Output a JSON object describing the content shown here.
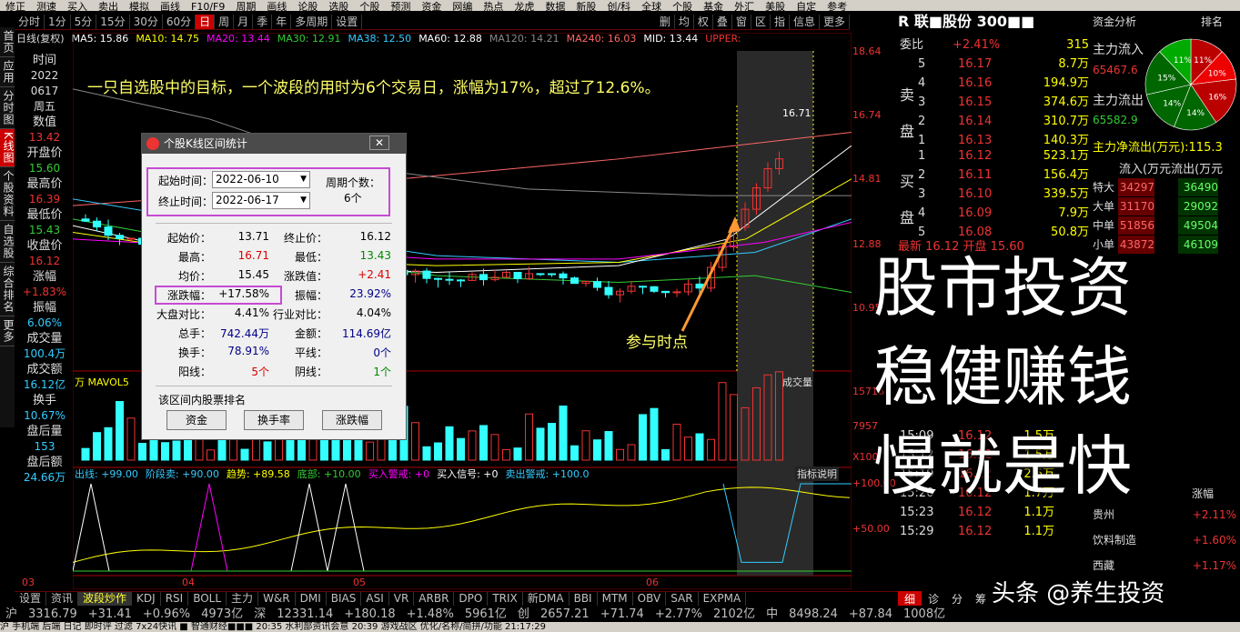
{
  "toolbar": {
    "items": [
      "修正",
      "测速",
      "买入",
      "卖出",
      "模拟",
      "画线",
      "F10/F9",
      "周期",
      "画线",
      "论股",
      "选股",
      "个股",
      "预测",
      "资金",
      "网编",
      "热点",
      "龙虎",
      "数据",
      "新股",
      "创/科",
      "全球",
      "个股",
      "基金",
      "外汇",
      "美股",
      "自定",
      "参考"
    ]
  },
  "period_tabs": [
    "分时",
    "1分",
    "5分",
    "15分",
    "30分",
    "60分",
    "日",
    "周",
    "月",
    "季",
    "年",
    "多周期",
    "设置"
  ],
  "period_active": "日",
  "period_right": [
    "删",
    "均",
    "权",
    "叠",
    "窗",
    "区",
    "指",
    "信息",
    "更多"
  ],
  "left_nav": [
    "首页",
    "应用",
    "分时图",
    "K线图",
    "个股资料",
    "自选股",
    "综合排名",
    "更多"
  ],
  "left_nav_active": "K线图",
  "info": [
    {
      "label": "时间",
      "value": "2022",
      "color": "#ddd"
    },
    {
      "label": "",
      "value": "0617",
      "color": "#ddd"
    },
    {
      "label": "",
      "value": "周五",
      "color": "#ddd"
    },
    {
      "label": "数值",
      "value": "13.42",
      "color": "#e33"
    },
    {
      "label": "开盘价",
      "value": "15.60",
      "color": "#3c3"
    },
    {
      "label": "最高价",
      "value": "16.39",
      "color": "#e33"
    },
    {
      "label": "最低价",
      "value": "15.43",
      "color": "#3c3"
    },
    {
      "label": "收盘价",
      "value": "16.12",
      "color": "#e33"
    },
    {
      "label": "涨幅",
      "value": "+1.83%",
      "color": "#e33"
    },
    {
      "label": "振幅",
      "value": "6.06%",
      "color": "#3cf"
    },
    {
      "label": "成交量",
      "value": "100.4万",
      "color": "#3cf"
    },
    {
      "label": "成交额",
      "value": "16.12亿",
      "color": "#3cf"
    },
    {
      "label": "换手",
      "value": "10.67%",
      "color": "#3cf"
    },
    {
      "label": "盘后量",
      "value": "153",
      "color": "#3cf"
    },
    {
      "label": "盘后额",
      "value": "24.66万",
      "color": "#3cf"
    }
  ],
  "ma_legend": [
    {
      "text": "日线(复权)",
      "color": "#ddd"
    },
    {
      "text": "MA5: 15.86",
      "color": "#fff"
    },
    {
      "text": "MA10: 14.75",
      "color": "#ff0"
    },
    {
      "text": "MA20: 13.44",
      "color": "#f0f"
    },
    {
      "text": "MA30: 12.91",
      "color": "#3c3"
    },
    {
      "text": "MA38: 12.50",
      "color": "#3cf"
    },
    {
      "text": "MA60: 12.88",
      "color": "#fff"
    },
    {
      "text": "MA120: 14.21",
      "color": "#888"
    },
    {
      "text": "MA240: 16.03",
      "color": "#f66"
    },
    {
      "text": "MID: 13.44",
      "color": "#fff"
    },
    {
      "text": "UPPER:",
      "color": "#e33"
    }
  ],
  "annotation": "一只自选股中的目标，一个波段的用时为6个交易日，涨幅为17%，超过了12.6%。",
  "annotation2": "参与时点",
  "peak_label": "16.71",
  "price_axis": [
    "18.64",
    "16.74",
    "14.81",
    "12.88",
    "10.95"
  ],
  "volume_axis": [
    "15716",
    "7957",
    "X100"
  ],
  "vol_legend": "万  MAVOL5",
  "vol_title": "成交量",
  "indicator_legend": [
    {
      "text": "出线: +99.00",
      "color": "#3cf"
    },
    {
      "text": "阶段卖: +90.00",
      "color": "#3cf"
    },
    {
      "text": "趋势: +89.58",
      "color": "#ff0"
    },
    {
      "text": "底部: +10.00",
      "color": "#3c3"
    },
    {
      "text": "买入警戒: +0",
      "color": "#f0f"
    },
    {
      "text": "买入信号: +0",
      "color": "#fff"
    },
    {
      "text": "卖出警戒: +100.0",
      "color": "#3cf"
    }
  ],
  "indicator_btn": "指标说明",
  "indicator_axis": [
    "+100.00",
    "+50.00"
  ],
  "x_axis": [
    "03",
    "04",
    "05",
    "06"
  ],
  "dialog": {
    "title": "个股K线区间统计",
    "start_label": "起始时间：",
    "start_value": "2022-06-10",
    "end_label": "终止时间：",
    "end_value": "2022-06-17",
    "period_label": "周期个数：",
    "period_value": "6个",
    "rows": [
      {
        "l1": "起始价：",
        "v1": "13.71",
        "c1": "#000",
        "l2": "终止价：",
        "v2": "16.12",
        "c2": "#000"
      },
      {
        "l1": "最高：",
        "v1": "16.71",
        "c1": "#d00",
        "l2": "最低：",
        "v2": "13.43",
        "c2": "#080"
      },
      {
        "l1": "均价：",
        "v1": "15.45",
        "c1": "#000",
        "l2": "涨跌值：",
        "v2": "+2.41",
        "c2": "#d00"
      },
      {
        "l1": "涨跌幅：",
        "v1": "+17.58%",
        "c1": "#000",
        "l2": "振幅：",
        "v2": "23.92%",
        "c2": "#008"
      },
      {
        "l1": "大盘对比：",
        "v1": "4.41%",
        "c1": "#000",
        "l2": "行业对比：",
        "v2": "4.04%",
        "c2": "#000"
      },
      {
        "l1": "总手：",
        "v1": "742.44万",
        "c1": "#008",
        "l2": "金额：",
        "v2": "114.69亿",
        "c2": "#008"
      },
      {
        "l1": "换手：",
        "v1": "78.91%",
        "c1": "#008",
        "l2": "平线：",
        "v2": "0个",
        "c2": "#008"
      },
      {
        "l1": "阳线：",
        "v1": "5个",
        "c1": "#d00",
        "l2": "阴线：",
        "v2": "1个",
        "c2": "#080"
      }
    ],
    "rank_label": "该区间内股票排名",
    "buttons": [
      "资金",
      "换手率",
      "涨跌幅"
    ]
  },
  "quote": {
    "title": "R 联■股份 300■■",
    "wb_label": "委比",
    "wb_value": "+2.41%",
    "wb_num": "315",
    "sell": [
      {
        "n": "5",
        "p": "16.17",
        "v": "8.7万"
      },
      {
        "n": "4",
        "p": "16.16",
        "v": "194.9万"
      },
      {
        "n": "3",
        "p": "16.15",
        "v": "374.6万"
      },
      {
        "n": "2",
        "p": "16.14",
        "v": "310.7万"
      },
      {
        "n": "1",
        "p": "16.13",
        "v": "140.3万"
      }
    ],
    "buy": [
      {
        "n": "1",
        "p": "16.12",
        "v": "523.1万"
      },
      {
        "n": "2",
        "p": "16.11",
        "v": "156.4万"
      },
      {
        "n": "3",
        "p": "16.10",
        "v": "339.5万"
      },
      {
        "n": "4",
        "p": "16.09",
        "v": "7.9万"
      },
      {
        "n": "5",
        "p": "16.08",
        "v": "50.8万"
      }
    ],
    "sell_label": "卖盘",
    "buy_label": "买盘",
    "latest": "最新  16.12  开盘  15.60",
    "ticks": [
      {
        "t": "15:09",
        "p": "16.12",
        "v": "1.5万"
      },
      {
        "t": "15:12",
        "p": "16.12",
        "v": "1.5万"
      },
      {
        "t": "15:19",
        "p": "16.12",
        "v": "2.6万"
      },
      {
        "t": "15:20",
        "p": "16.12",
        "v": "1.7万"
      },
      {
        "t": "15:23",
        "p": "16.12",
        "v": "1.1万"
      },
      {
        "t": "15:29",
        "p": "16.12",
        "v": "1.1万"
      }
    ],
    "bottom_tabs": [
      "细",
      "诊",
      "分",
      "筹"
    ]
  },
  "fund": {
    "title": "资金分析",
    "rank": "排名",
    "main_in": "主力流入",
    "main_in_v": "65467.6",
    "main_out": "主力流出",
    "main_out_v": "65582.9",
    "net": "主力净流出(万元):115.3",
    "cols": "流入(万元流出(万元",
    "rows": [
      {
        "l": "特大",
        "a": "34297",
        "b": "36490"
      },
      {
        "l": "大单",
        "a": "31170",
        "b": "29092"
      },
      {
        "l": "中单",
        "a": "51856",
        "b": "49504"
      },
      {
        "l": "小单",
        "a": "43872",
        "b": "46109"
      }
    ],
    "pie": [
      {
        "label": "11%",
        "color": "#c00"
      },
      {
        "label": "10%",
        "color": "#c00"
      },
      {
        "label": "16%",
        "color": "#c00"
      },
      {
        "label": "14%",
        "color": "#060"
      },
      {
        "label": "14%",
        "color": "#060"
      },
      {
        "label": "15%",
        "color": "#060"
      },
      {
        "label": "11%",
        "color": "#060"
      }
    ],
    "rank_rows": [
      {
        "n": "贵州",
        "v": "+2.11%"
      },
      {
        "n": "饮料制造",
        "v": "+1.60%"
      },
      {
        "n": "西藏",
        "v": "+1.17%"
      }
    ],
    "rank_head": "涨幅"
  },
  "overlay_text": [
    "股市投资",
    "稳健赚钱",
    "慢就是快"
  ],
  "watermark": "头条 @养生投资",
  "bottom_tabs": [
    "设置",
    "资讯",
    "波段炒作",
    "KDJ",
    "RSI",
    "BOLL",
    "主力",
    "W&R",
    "DMI",
    "BIAS",
    "ASI",
    "VR",
    "ARBR",
    "DPO",
    "TRIX",
    "新DMA",
    "BBI",
    "MTM",
    "OBV",
    "SAR",
    "EXPMA"
  ],
  "bottom_tab_active": "波段炒作",
  "index_bar": [
    {
      "t": "沪",
      "c": "#ddd"
    },
    {
      "t": "3316.79",
      "c": "#e33"
    },
    {
      "t": "+31.41",
      "c": "#e33"
    },
    {
      "t": "+0.96%",
      "c": "#e33"
    },
    {
      "t": "4973亿",
      "c": "#3cf"
    },
    {
      "t": "深",
      "c": "#ddd"
    },
    {
      "t": "12331.14",
      "c": "#e33"
    },
    {
      "t": "+180.18",
      "c": "#e33"
    },
    {
      "t": "+1.48%",
      "c": "#e33"
    },
    {
      "t": "5961亿",
      "c": "#3cf"
    },
    {
      "t": "创",
      "c": "#ddd"
    },
    {
      "t": "2657.21",
      "c": "#e33"
    },
    {
      "t": "+71.74",
      "c": "#e33"
    },
    {
      "t": "+2.77%",
      "c": "#e33"
    },
    {
      "t": "2102亿",
      "c": "#3cf"
    },
    {
      "t": "中",
      "c": "#ddd"
    },
    {
      "t": "8498.24",
      "c": "#e33"
    },
    {
      "t": "+87.84",
      "c": "#e33"
    },
    {
      "t": "1008亿",
      "c": "#3cf"
    }
  ],
  "status_bar": "沪  手机端  后端  日记  即时评  过滤  7x24快讯  ■  智通财经■■■  20:35 水利部资讯会意  20:39 游戏战区  优化/名称/简拼/功能  21:17:29"
}
